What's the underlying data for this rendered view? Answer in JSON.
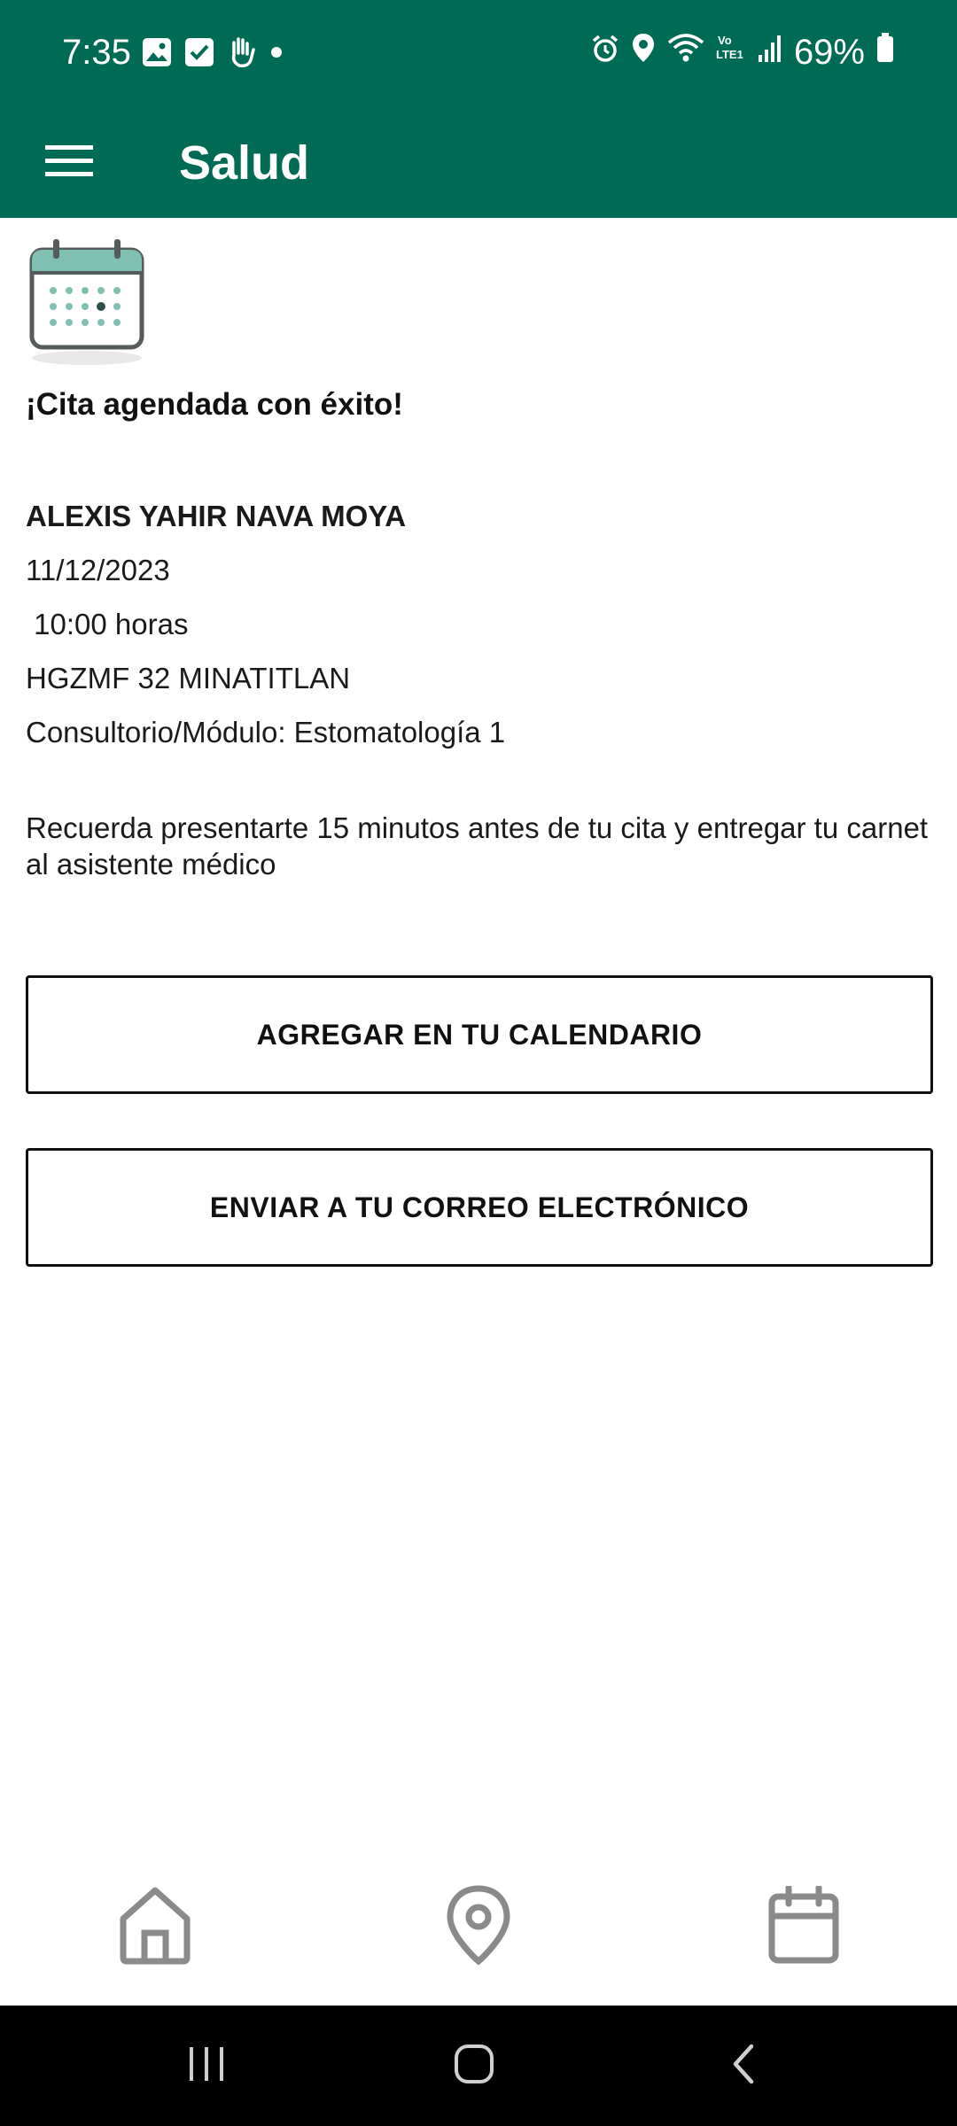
{
  "status_bar": {
    "time": "7:35",
    "battery": "69%",
    "icons_left": [
      "gallery-icon",
      "check-icon",
      "hand-icon",
      "dot-icon"
    ],
    "icons_right": [
      "alarm-icon",
      "location-icon",
      "wifi-icon",
      "volte-icon",
      "signal-icon",
      "battery-icon"
    ]
  },
  "app_bar": {
    "title": "Salud",
    "menu_icon": "hamburger-menu-icon"
  },
  "confirmation": {
    "title": "¡Cita agendada con éxito!",
    "patient_name": "ALEXIS YAHIR NAVA MOYA",
    "date": "11/12/2023",
    "time": " 10:00 horas",
    "clinic": "HGZMF 32 MINATITLAN",
    "office": "Consultorio/Módulo: Estomatología 1",
    "reminder": "Recuerda presentarte 15 minutos antes de tu cita y entregar tu carnet al asistente médico"
  },
  "actions": {
    "add_calendar": "AGREGAR EN TU CALENDARIO",
    "send_email": "ENVIAR A TU CORREO ELECTRÓNICO"
  },
  "bottom_nav": {
    "items": [
      "home-icon",
      "location-pin-icon",
      "calendar-icon"
    ]
  },
  "colors": {
    "primary": "#006b55",
    "nav_icon": "#8a8a8a",
    "text": "#111111"
  }
}
